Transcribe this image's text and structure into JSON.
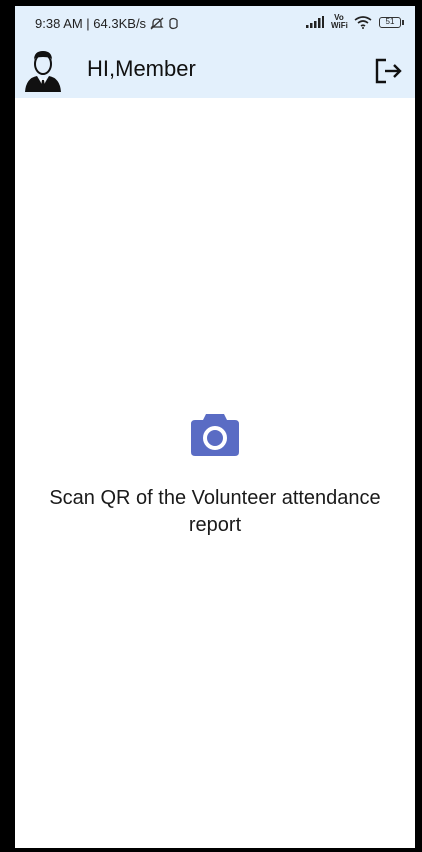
{
  "status_bar": {
    "time_and_speed": "9:38 AM | 64.3KB/s",
    "network_label": "Vo WiFi",
    "battery_level": "51"
  },
  "header": {
    "greeting": "HI,Member",
    "avatar_icon": "user-avatar-icon",
    "logout_icon": "logout-icon"
  },
  "main": {
    "camera_icon": "camera-icon",
    "scan_instruction": "Scan QR of the Volunteer attendance report"
  },
  "colors": {
    "header_bg": "#e3f0fc",
    "camera_accent": "#5a6cc4",
    "page_bg": "#ffffff",
    "frame_bg": "#000000"
  }
}
